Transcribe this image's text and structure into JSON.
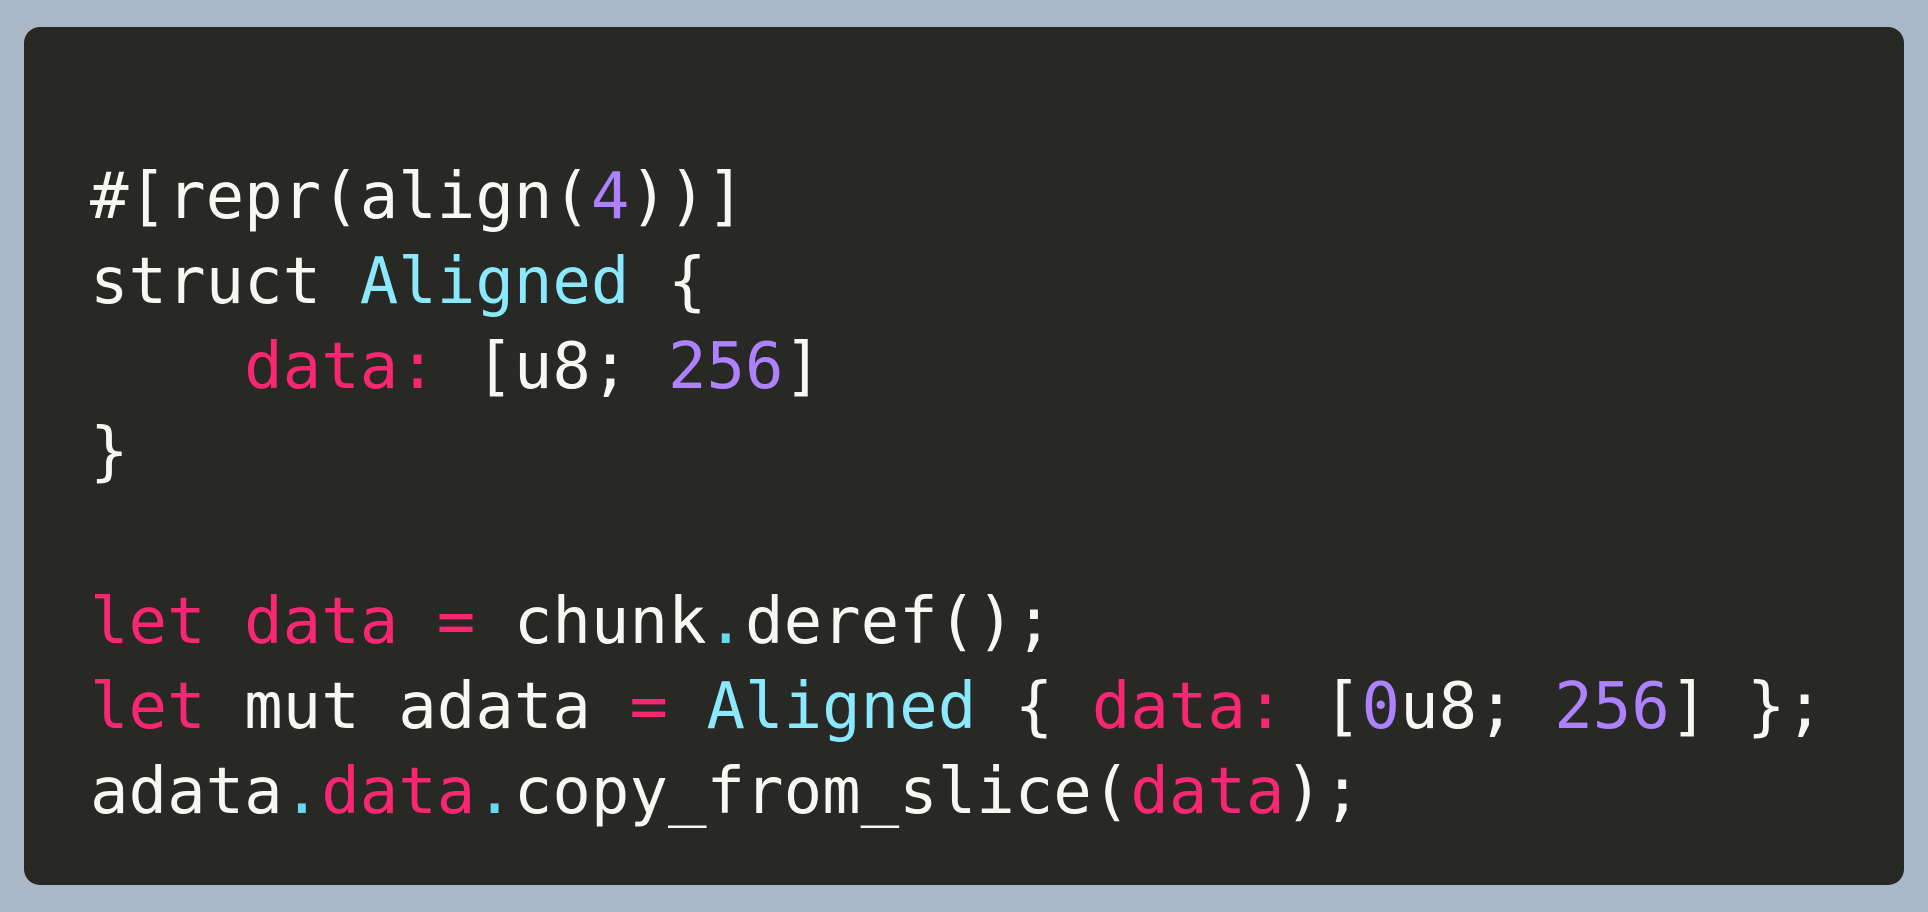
{
  "colors": {
    "background": "#a9b7c6",
    "editor": "#282824",
    "plain": "#f8f8f2",
    "type": "#8be9fd",
    "keyword": "#f92672",
    "number": "#ae81ff",
    "dot": "#66d9ef"
  },
  "code": {
    "lines": [
      [
        {
          "t": "#[repr(align(",
          "k": "plain"
        },
        {
          "t": "4",
          "k": "number"
        },
        {
          "t": "))]",
          "k": "plain"
        }
      ],
      [
        {
          "t": "struct ",
          "k": "plain"
        },
        {
          "t": "Aligned",
          "k": "type"
        },
        {
          "t": " {",
          "k": "plain"
        }
      ],
      [
        {
          "t": "    ",
          "k": "plain"
        },
        {
          "t": "data:",
          "k": "field"
        },
        {
          "t": " [u8; ",
          "k": "plain"
        },
        {
          "t": "256",
          "k": "number"
        },
        {
          "t": "]",
          "k": "plain"
        }
      ],
      [
        {
          "t": "}",
          "k": "plain"
        }
      ],
      [],
      [
        {
          "t": "let",
          "k": "keyword"
        },
        {
          "t": " ",
          "k": "plain"
        },
        {
          "t": "data",
          "k": "field"
        },
        {
          "t": " ",
          "k": "plain"
        },
        {
          "t": "=",
          "k": "op"
        },
        {
          "t": " chunk",
          "k": "plain"
        },
        {
          "t": ".",
          "k": "dot"
        },
        {
          "t": "deref();",
          "k": "plain"
        }
      ],
      [
        {
          "t": "let",
          "k": "keyword"
        },
        {
          "t": " mut adata ",
          "k": "plain"
        },
        {
          "t": "=",
          "k": "op"
        },
        {
          "t": " ",
          "k": "plain"
        },
        {
          "t": "Aligned",
          "k": "type"
        },
        {
          "t": " { ",
          "k": "plain"
        },
        {
          "t": "data:",
          "k": "field"
        },
        {
          "t": " [",
          "k": "plain"
        },
        {
          "t": "0",
          "k": "number"
        },
        {
          "t": "u8; ",
          "k": "plain"
        },
        {
          "t": "256",
          "k": "number"
        },
        {
          "t": "] };",
          "k": "plain"
        }
      ],
      [
        {
          "t": "adata",
          "k": "plain"
        },
        {
          "t": ".",
          "k": "dot"
        },
        {
          "t": "data",
          "k": "field"
        },
        {
          "t": ".",
          "k": "dot"
        },
        {
          "t": "copy_from_slice(",
          "k": "plain"
        },
        {
          "t": "data",
          "k": "field"
        },
        {
          "t": ");",
          "k": "plain"
        }
      ]
    ]
  }
}
